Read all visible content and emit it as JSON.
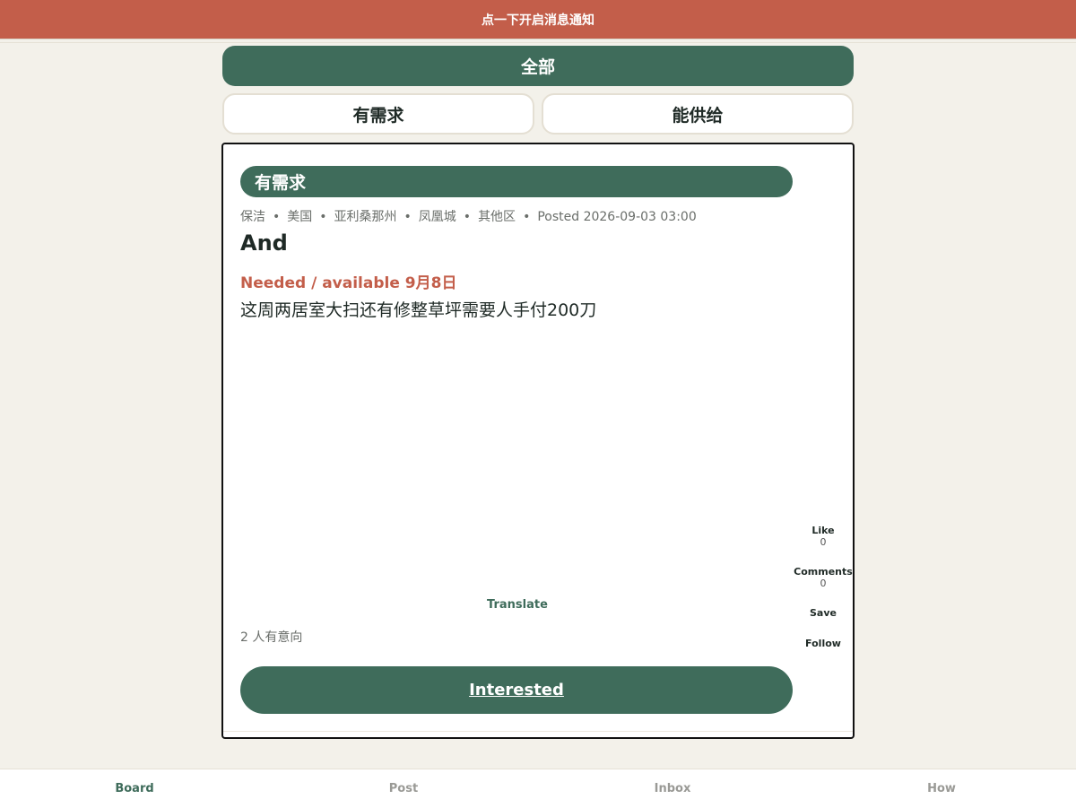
{
  "banner": {
    "text": "点一下开启消息通知"
  },
  "filters": {
    "all": "全部",
    "need": "有需求",
    "supply": "能供给"
  },
  "post": {
    "tag": "有需求",
    "meta": [
      "保洁",
      "美国",
      "亚利桑那州",
      "凤凰城",
      "其他区",
      "Posted 2026-09-03 03:00"
    ],
    "title": "And",
    "date_line": "Needed / available 9月8日",
    "body": "这周两居室大扫还有修整草坪需要人手付200刀",
    "actions": {
      "like_label": "Like",
      "like_count": "0",
      "comments_label": "Comments",
      "comments_count": "0",
      "save_label": "Save",
      "follow_label": "Follow"
    },
    "translate_label": "Translate",
    "interest_count": "2 人有意向",
    "interested_label": "Interested"
  },
  "nav": {
    "board": "Board",
    "post": "Post",
    "inbox": "Inbox",
    "how": "How"
  },
  "colors": {
    "accent": "#3f6c5b",
    "banner": "#c35e4a",
    "background": "#f3f1ea"
  }
}
